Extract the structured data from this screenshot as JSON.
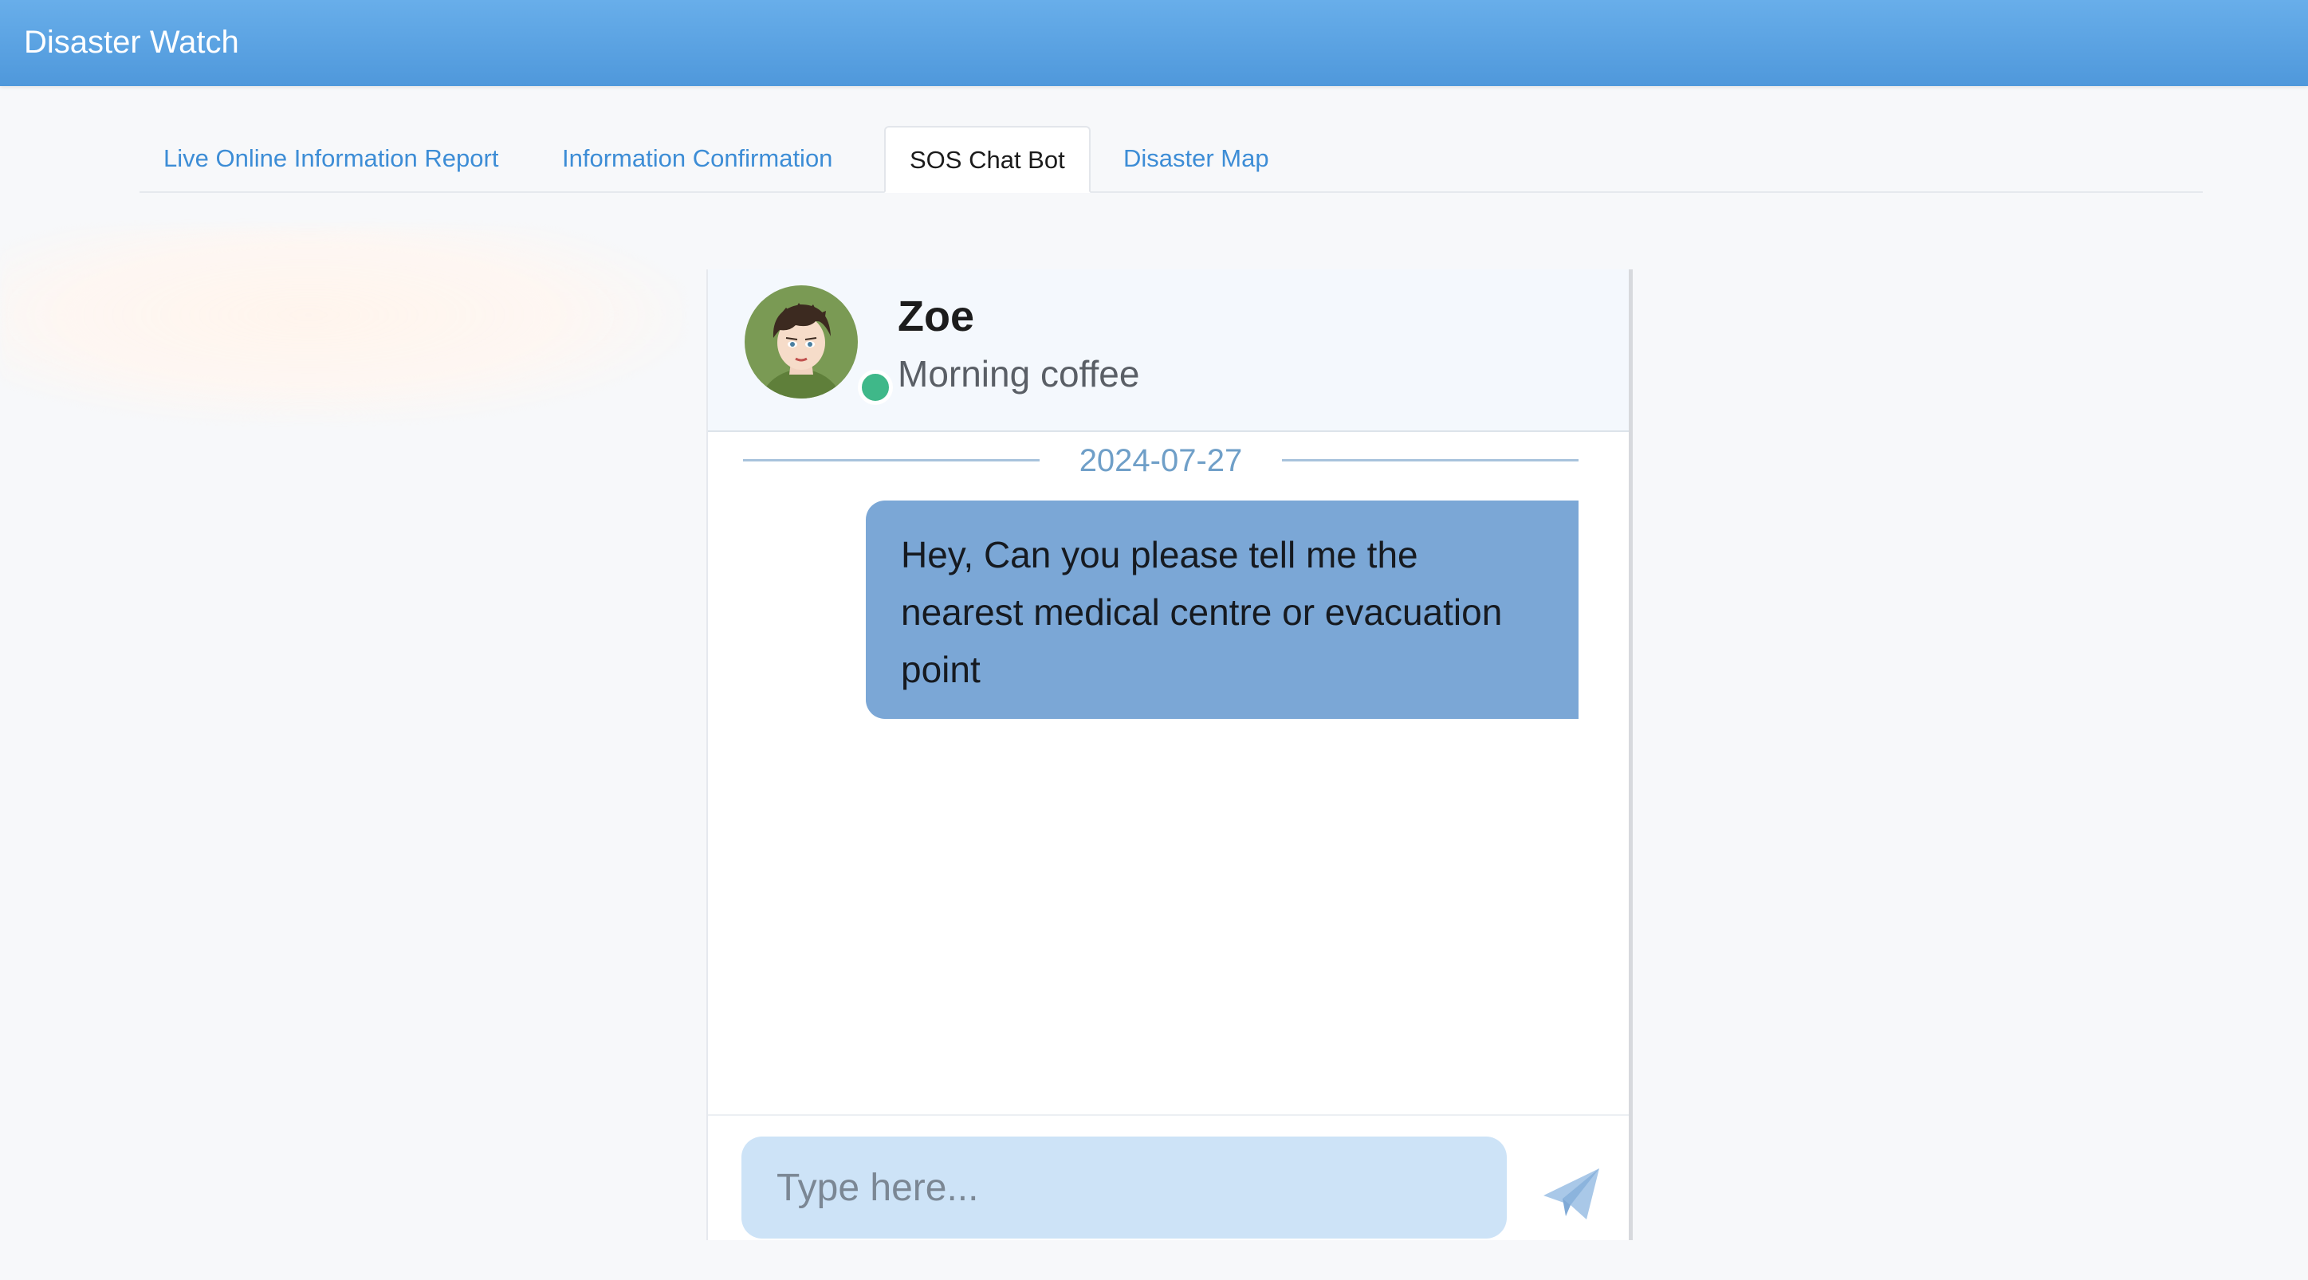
{
  "app": {
    "title": "Disaster Watch"
  },
  "tabs": [
    {
      "label": "Live Online Information Report",
      "active": false
    },
    {
      "label": "Information Confirmation",
      "active": false
    },
    {
      "label": "SOS Chat Bot",
      "active": true
    },
    {
      "label": "Disaster Map",
      "active": false
    }
  ],
  "chat": {
    "contact": {
      "name": "Zoe",
      "status": "Morning coffee",
      "online": true,
      "avatar_icon": "cartoon-person-avatar"
    },
    "date_separator": "2024-07-27",
    "messages": [
      {
        "from": "user",
        "text": "Hey, Can you please tell me the nearest medical centre or evacuation point"
      }
    ],
    "composer": {
      "placeholder": "Type here...",
      "value": "",
      "send_icon": "paper-plane-icon"
    }
  },
  "colors": {
    "header_bar": "#5aa2e2",
    "tab_link": "#3d8dd6",
    "bubble": "#7ba7d6",
    "input_bg": "#cde3f7",
    "online": "#3fb889"
  }
}
